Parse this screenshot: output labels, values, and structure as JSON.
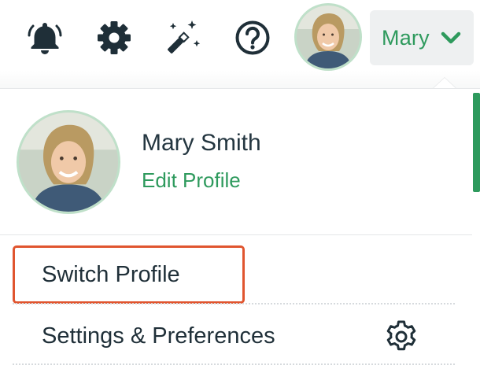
{
  "header": {
    "notifications_icon": "bell-icon",
    "settings_icon": "gear-icon",
    "magic_icon": "magic-wand-icon",
    "help_icon": "help-circle-icon",
    "user_button_label": "Mary",
    "user_button_icon": "chevron-down-icon"
  },
  "profile": {
    "full_name": "Mary Smith",
    "edit_label": "Edit Profile"
  },
  "menu": {
    "items": [
      {
        "label": "Switch Profile",
        "icon": ""
      },
      {
        "label": "Settings & Preferences",
        "icon": "gear-icon"
      }
    ]
  },
  "colors": {
    "accent": "#2e9a5d",
    "icon_dark": "#1f2f38",
    "highlight": "#e0552f",
    "button_bg": "#eef0f1"
  }
}
